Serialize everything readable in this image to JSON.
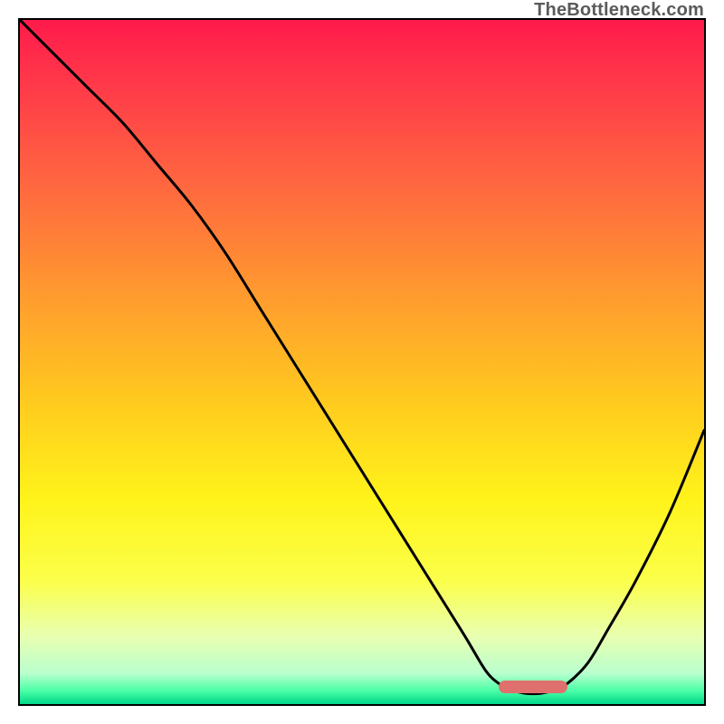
{
  "watermark": "TheBottleneck.com",
  "marker": {
    "color": "#e0706d",
    "x_frac_start": 0.7,
    "x_frac_end": 0.8,
    "y_frac": 0.975
  },
  "gradient_stops": [
    {
      "offset": 0.0,
      "color": "#ff1a4b"
    },
    {
      "offset": 0.1,
      "color": "#ff3b49"
    },
    {
      "offset": 0.25,
      "color": "#ff6a3f"
    },
    {
      "offset": 0.4,
      "color": "#ff9a2f"
    },
    {
      "offset": 0.55,
      "color": "#ffc81f"
    },
    {
      "offset": 0.7,
      "color": "#fff31a"
    },
    {
      "offset": 0.82,
      "color": "#fbff4a"
    },
    {
      "offset": 0.9,
      "color": "#e9ffb0"
    },
    {
      "offset": 0.955,
      "color": "#b9ffce"
    },
    {
      "offset": 0.98,
      "color": "#4dffa7"
    },
    {
      "offset": 1.0,
      "color": "#00d88a"
    }
  ],
  "chart_data": {
    "type": "line",
    "title": "",
    "xlabel": "",
    "ylabel": "",
    "xlim": [
      0,
      100
    ],
    "ylim": [
      0,
      100
    ],
    "series": [
      {
        "name": "bottleneck-curve",
        "x": [
          0,
          5,
          10,
          15,
          20,
          25,
          30,
          35,
          40,
          45,
          50,
          55,
          60,
          65,
          68,
          70,
          72,
          75,
          78,
          80,
          83,
          86,
          90,
          95,
          100
        ],
        "y": [
          100,
          95,
          90,
          85,
          79,
          73,
          66,
          58,
          50,
          42,
          34,
          26,
          18,
          10,
          5,
          3,
          2,
          1.5,
          2,
          3,
          6,
          11,
          18,
          28,
          40
        ]
      }
    ],
    "optimal_band_x": [
      70,
      80
    ]
  }
}
